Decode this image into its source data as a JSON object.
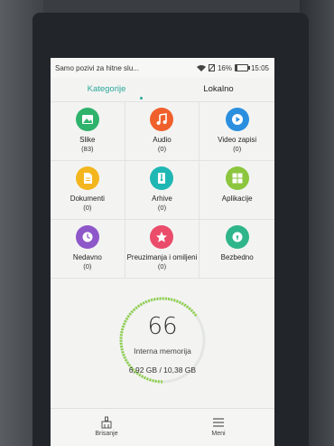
{
  "status": {
    "notification": "Samo pozivi za hitne slu...",
    "battery_percent": "16%",
    "battery_level": 0.16,
    "time": "15:05"
  },
  "tabs": [
    {
      "label": "Kategorije",
      "active": true
    },
    {
      "label": "Lokalno",
      "active": false
    }
  ],
  "categories": [
    {
      "label": "Slike",
      "count": "(83)",
      "icon": "image-icon",
      "color": "#2fb36c"
    },
    {
      "label": "Audio",
      "count": "(0)",
      "icon": "music-icon",
      "color": "#f0602c"
    },
    {
      "label": "Video zapisi",
      "count": "(0)",
      "icon": "video-icon",
      "color": "#2b8fe0"
    },
    {
      "label": "Dokumenti",
      "count": "(0)",
      "icon": "document-icon",
      "color": "#f3b61f"
    },
    {
      "label": "Arhive",
      "count": "(0)",
      "icon": "archive-icon",
      "color": "#1fb7b3"
    },
    {
      "label": "Aplikacije",
      "count": "",
      "icon": "apps-icon",
      "color": "#8cc63e"
    },
    {
      "label": "Nedavno",
      "count": "(0)",
      "icon": "clock-icon",
      "color": "#8e57c9"
    },
    {
      "label": "Preuzimanja i omiljeni",
      "count": "(0)",
      "icon": "star-icon",
      "color": "#ea4c6a"
    },
    {
      "label": "Bezbedno",
      "count": "",
      "icon": "safe-icon",
      "color": "#2fb58a"
    }
  ],
  "storage": {
    "percent": "66",
    "percent_value": 0.66,
    "label": "Interna memorija",
    "usage": "6,92 GB / 10,38 GB",
    "ring_color": "#8cd14a"
  },
  "bottom": [
    {
      "label": "Brisanje",
      "icon": "broom-icon"
    },
    {
      "label": "Meni",
      "icon": "menu-icon"
    }
  ]
}
